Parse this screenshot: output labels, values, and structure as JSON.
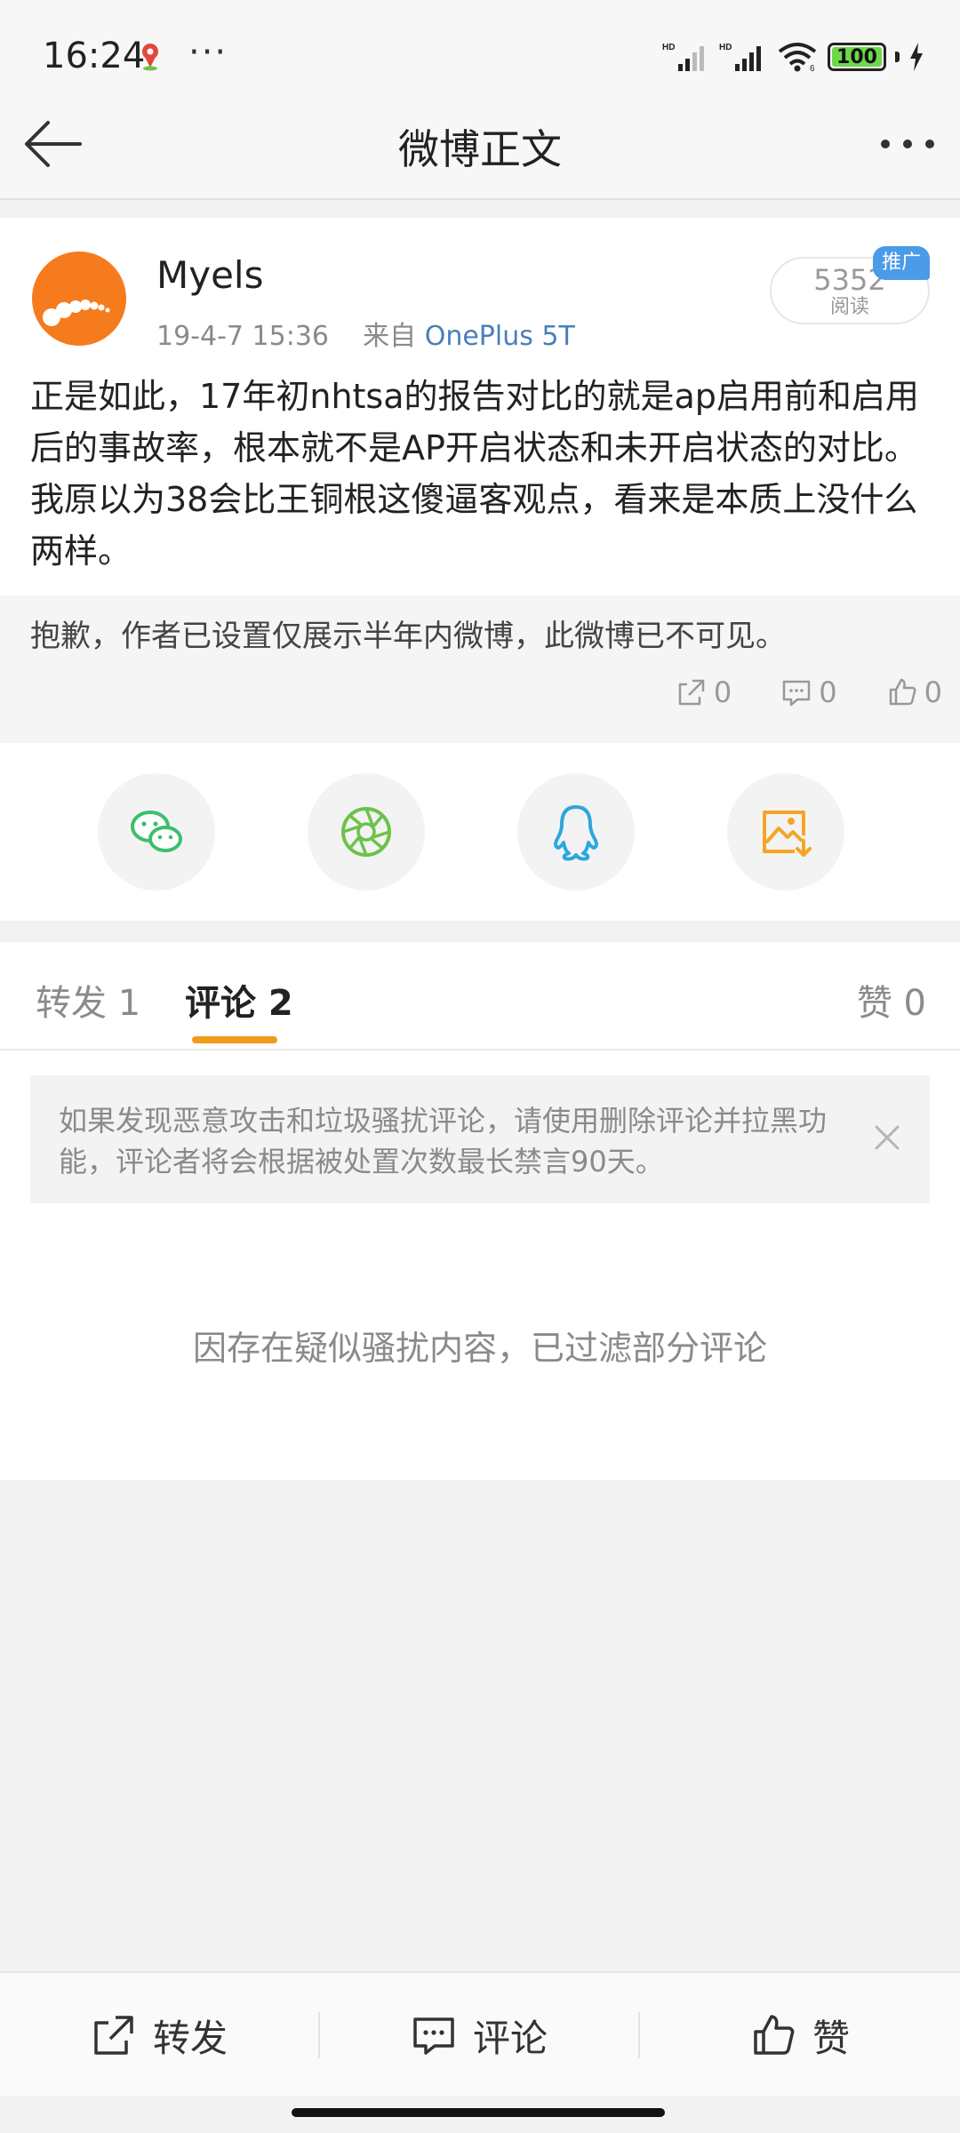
{
  "status_bar": {
    "time": "16:24",
    "dots": "···",
    "battery": "100",
    "icons": [
      "map-pin-icon",
      "hd-signal-icon",
      "wifi-icon",
      "battery-icon",
      "charging-icon"
    ]
  },
  "nav": {
    "title": "微博正文",
    "icons": [
      "back-arrow-icon",
      "more-icon"
    ]
  },
  "post": {
    "username": "Myels",
    "time": "19-4-7 15:36",
    "source_prefix": "来自",
    "device": "OnePlus 5T",
    "read_count": "5352",
    "read_label": "阅读",
    "promo_tag": "推广",
    "body": "正是如此，17年初nhtsa的报告对比的就是ap启用前和启用后的事故率，根本就不是AP开启状态和未开启状态的对比。我原以为38会比王铜根这傻逼客观点，看来是本质上没什么两样。"
  },
  "retweet": {
    "text": "抱歉，作者已设置仅展示半年内微博，此微博已不可见。",
    "repost_count": "0",
    "comment_count": "0",
    "like_count": "0"
  },
  "share": {
    "icons": [
      "wechat-icon",
      "moments-icon",
      "qq-icon",
      "save-image-icon"
    ],
    "colors": {
      "wechat": "#3dbf6b",
      "moments": "#6cc24a",
      "qq": "#2da6e0",
      "save_image": "#f5a524"
    }
  },
  "tabs": {
    "repost": "转发 1",
    "comments": "评论 2",
    "likes": "赞 0",
    "accent_color": "#f29a1d"
  },
  "notice": {
    "text": "如果发现恶意攻击和垃圾骚扰评论，请使用删除评论并拉黑功能，评论者将会根据被处置次数最长禁言90天。"
  },
  "filtered_text": "因存在疑似骚扰内容，已过滤部分评论",
  "bottom_bar": {
    "repost": "转发",
    "comment": "评论",
    "like": "赞"
  }
}
